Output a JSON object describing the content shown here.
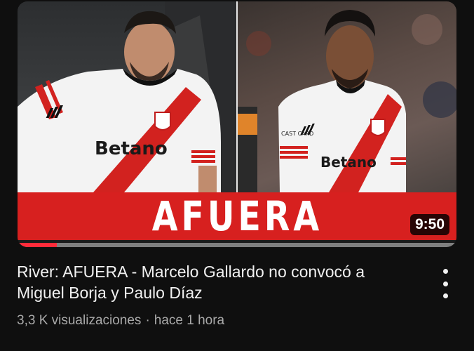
{
  "thumbnail": {
    "banner_text": "AFUERA",
    "duration": "9:50",
    "watch_progress": 0.09,
    "jersey_sponsor": "Betano",
    "jersey_sleeve_text": "CAST CARD",
    "banner_color": "#d7201f",
    "progress_color": "#ff2b3a"
  },
  "video": {
    "title": "River: AFUERA - Marcelo Gallardo no convocó a Miguel Borja y Paulo Díaz",
    "views": "3,3 K visualizaciones",
    "separator": "·",
    "age": "hace 1 hora"
  },
  "icons": {
    "more": "kebab-menu-icon"
  }
}
